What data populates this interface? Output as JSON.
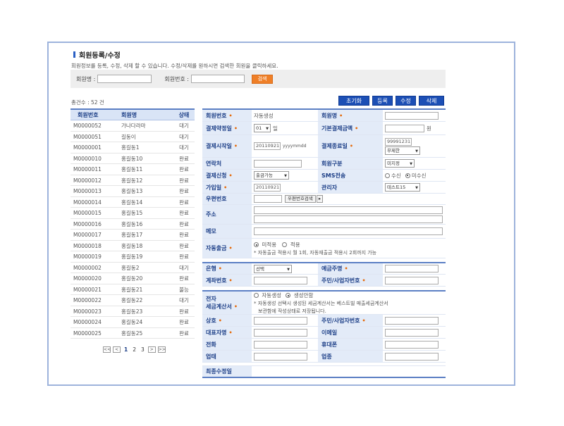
{
  "title": "회원등록/수정",
  "description": "회원정보를 등록, 수정, 삭제 할 수 있습니다. 수정/삭제를 원하시면 검색한 회원을 클릭하세요.",
  "search": {
    "name_label": "회원명 :",
    "no_label": "회원번호 :",
    "button": "검색"
  },
  "total": "총건수 : 52 건",
  "buttons": {
    "reset": "초기화",
    "register": "등록",
    "modify": "수정",
    "delete": "삭제"
  },
  "list": {
    "headers": [
      "회원번호",
      "회원명",
      "상태"
    ],
    "rows": [
      [
        "M0000052",
        "가나다라마",
        "대기"
      ],
      [
        "M0000051",
        "길동이",
        "대기"
      ],
      [
        "M0000001",
        "홍길동1",
        "대기"
      ],
      [
        "M0000010",
        "홍길동10",
        "완료"
      ],
      [
        "M0000011",
        "홍길동11",
        "완료"
      ],
      [
        "M0000012",
        "홍길동12",
        "완료"
      ],
      [
        "M0000013",
        "홍길동13",
        "완료"
      ],
      [
        "M0000014",
        "홍길동14",
        "완료"
      ],
      [
        "M0000015",
        "홍길동15",
        "완료"
      ],
      [
        "M0000016",
        "홍길동16",
        "완료"
      ],
      [
        "M0000017",
        "홍길동17",
        "완료"
      ],
      [
        "M0000018",
        "홍길동18",
        "완료"
      ],
      [
        "M0000019",
        "홍길동19",
        "완료"
      ],
      [
        "M0000002",
        "홍길동2",
        "대기"
      ],
      [
        "M0000020",
        "홍길동20",
        "완료"
      ],
      [
        "M0000021",
        "홍길동21",
        "불능"
      ],
      [
        "M0000022",
        "홍길동22",
        "대기"
      ],
      [
        "M0000023",
        "홍길동23",
        "완료"
      ],
      [
        "M0000024",
        "홍길동24",
        "완료"
      ],
      [
        "M0000025",
        "홍길동25",
        "완료"
      ]
    ]
  },
  "pager": {
    "first": "<<",
    "prev": "<",
    "pages": [
      "1",
      "2",
      "3"
    ],
    "next": ">",
    "last": ">>"
  },
  "form": {
    "member_no": "회원번호",
    "member_no_value": "자동생성",
    "member_name": "회원명",
    "pay_day": "결제약정일",
    "pay_day_value": "01",
    "pay_day_unit": "일",
    "base_amount": "기본결제금액",
    "base_amount_unit": "원",
    "start_date": "결제시작일",
    "start_date_value": "20110921",
    "start_date_format": "yyyymmdd",
    "end_date": "결제종료일",
    "end_date_value": "99991231",
    "end_date_option": "무제한",
    "contact": "연락처",
    "member_type": "회원구분",
    "member_type_value": "미지정",
    "pay_apply": "결제신청",
    "pay_apply_value": "출금가능",
    "sms": "SMS전송",
    "sms_receive": "수신",
    "sms_not_receive": "미수신",
    "join_date": "가입일",
    "join_date_value": "20110921",
    "manager": "관리자",
    "manager_value": "테스트15",
    "zipcode": "우편번호",
    "zipcode_button": "우편번호검색",
    "address": "주소",
    "memo": "메모",
    "auto_withdraw": "자동출금",
    "auto_not_apply": "미적용",
    "auto_apply": "적용",
    "auto_note": "* 자동출금 적용시 월 1회, 자동재출금 적용시 2회까지 가능",
    "bank": "은행",
    "bank_value": "선택",
    "depositor": "예금주명",
    "account": "계좌번호",
    "resident_no": "주민/사업자번호",
    "tax_invoice_1": "전자",
    "tax_invoice_2": "세금계산서",
    "tax_auto": "자동생성",
    "tax_none": "생성안함",
    "tax_note_1": "* 자동생성 선택시 생성된 세금계산서는 베스트빌 매출세금계산서",
    "tax_note_2": "보관함에 작성상태로 저장됩니다.",
    "company": "상호",
    "resident_no2": "주민/사업자번호",
    "ceo": "대표자명",
    "email": "이메일",
    "phone": "전화",
    "mobile": "휴대폰",
    "business": "업태",
    "category": "업종",
    "last_modified": "최종수정일"
  }
}
